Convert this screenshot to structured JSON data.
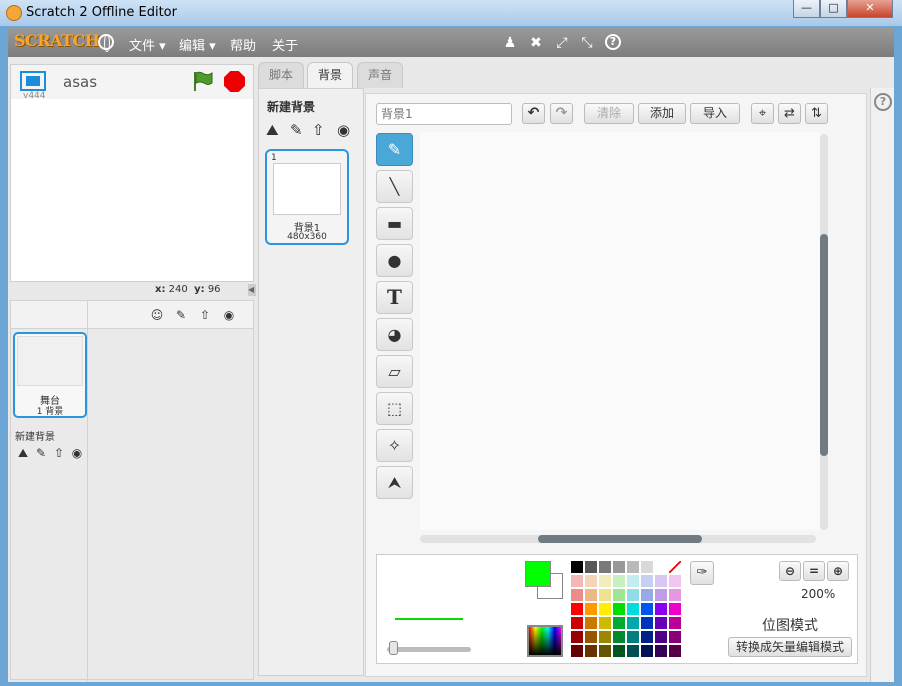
{
  "window": {
    "title": "Scratch 2 Offline Editor",
    "minimize": "—",
    "maximize": "□",
    "close": "✕"
  },
  "menubar": {
    "logo": "SCRATCH",
    "items": [
      "文件 ▾",
      "编辑 ▾",
      "帮助",
      "关于"
    ],
    "tool_icons": [
      "duplicate-stamp-icon",
      "cut-scissors-icon",
      "grow-icon",
      "shrink-icon",
      "help-icon"
    ]
  },
  "stage": {
    "version": "v444",
    "project_name": "asas",
    "coords_x_label": "x:",
    "coords_x": "240",
    "coords_y_label": "y:",
    "coords_y": "96"
  },
  "sprites": {
    "stage_thumb_name": "舞台",
    "stage_thumb_sub": "1 背景",
    "new_backdrop_label": "新建背景"
  },
  "tabs": [
    {
      "label": "脚本",
      "active": false
    },
    {
      "label": "背景",
      "active": true
    },
    {
      "label": "声音",
      "active": false
    }
  ],
  "costume_list": {
    "new_backdrop_title": "新建背景",
    "item_number": "1",
    "item_name": "背景1",
    "item_size": "480x360"
  },
  "editor": {
    "costume_name_placeholder": "背景1",
    "clear_label": "清除",
    "add_label": "添加",
    "import_label": "导入",
    "zoom_level": "200%",
    "mode_label": "位图模式",
    "convert_label": "转换成矢量编辑模式",
    "tools": [
      {
        "name": "brush-tool",
        "glyph": "✎",
        "active": true
      },
      {
        "name": "line-tool",
        "glyph": "╲",
        "active": false
      },
      {
        "name": "rectangle-tool",
        "glyph": "▬",
        "active": false
      },
      {
        "name": "ellipse-tool",
        "glyph": "●",
        "active": false
      },
      {
        "name": "text-tool",
        "glyph": "T",
        "active": false
      },
      {
        "name": "fill-tool",
        "glyph": "◕",
        "active": false
      },
      {
        "name": "eraser-tool",
        "glyph": "▱",
        "active": false
      },
      {
        "name": "select-tool",
        "glyph": "⬚",
        "active": false
      },
      {
        "name": "magic-select-tool",
        "glyph": "✧",
        "active": false
      },
      {
        "name": "stamp-tool",
        "glyph": "⮝",
        "active": false
      }
    ],
    "fg_color": "#00ff00",
    "bg_color": "#ffffff",
    "palette": [
      [
        "#000000",
        "#585858",
        "#797979",
        "#999999",
        "#b9b9b9",
        "#d9d9d9",
        "#ffffff",
        "none"
      ],
      [
        "#f4b7b7",
        "#f3d4b8",
        "#f3edbc",
        "#c7f0c1",
        "#c2ecf0",
        "#c4cff1",
        "#dbc6f1",
        "#f0c5ee"
      ],
      [
        "#ed8a8a",
        "#edb787",
        "#eee28f",
        "#9de695",
        "#91dde6",
        "#96abe6",
        "#c09be6",
        "#e697e2"
      ],
      [
        "#ff0000",
        "#ff9900",
        "#ffee00",
        "#00dd00",
        "#00dddd",
        "#0055ee",
        "#8800ee",
        "#ee00cc"
      ],
      [
        "#cc0000",
        "#cc7700",
        "#ccbb00",
        "#00aa33",
        "#00aaaa",
        "#0033bb",
        "#6600bb",
        "#bb0099"
      ],
      [
        "#990000",
        "#995500",
        "#998800",
        "#008833",
        "#007f7f",
        "#002288",
        "#4d0088",
        "#880077"
      ],
      [
        "#660000",
        "#663300",
        "#665500",
        "#005522",
        "#004f55",
        "#001155",
        "#330055",
        "#550044"
      ]
    ]
  }
}
